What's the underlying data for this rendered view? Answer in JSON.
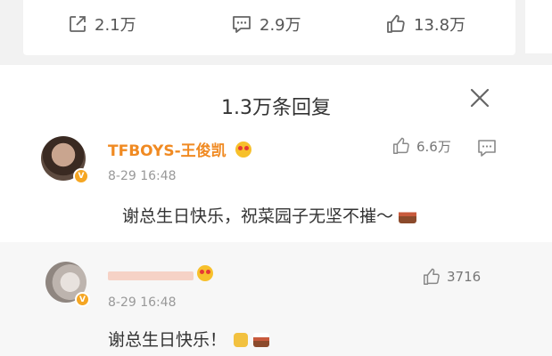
{
  "actions": {
    "repost_count": "2.1万",
    "comment_count": "2.9万",
    "like_count": "13.8万"
  },
  "sheet": {
    "title": "1.3万条回复"
  },
  "replies": [
    {
      "username": "TFBOYS-王俊凯",
      "time": "8-29 16:48",
      "text": "谢总生日快乐，祝菜园子无坚不摧～",
      "likes": "6.6万"
    },
    {
      "username": "",
      "time": "8-29 16:48",
      "text": "谢总生日快乐！",
      "likes": "3716"
    }
  ],
  "colors": {
    "username": "#f08a22",
    "verified_badge": "#f5a623",
    "background": "#f2f2f2"
  }
}
